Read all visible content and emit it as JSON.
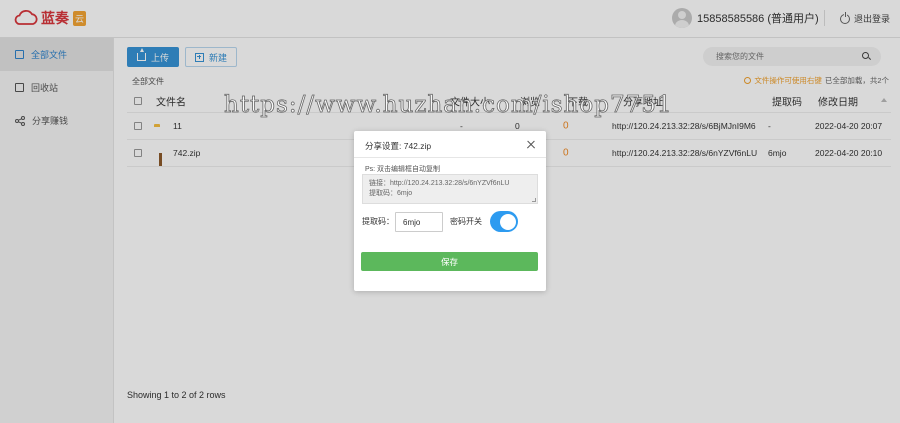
{
  "header": {
    "logo_text": "蓝奏",
    "logo_badge": "云",
    "username": "15858585586 (普通用户)",
    "logout_label": "退出登录"
  },
  "sidebar": {
    "items": [
      {
        "label": "全部文件",
        "icon": "file-icon",
        "active": true
      },
      {
        "label": "回收站",
        "icon": "trash-icon",
        "active": false
      },
      {
        "label": "分享赚钱",
        "icon": "share-icon",
        "active": false
      }
    ]
  },
  "toolbar": {
    "upload_label": "上传",
    "new_label": "新建",
    "search_placeholder": "搜索您的文件"
  },
  "breadcrumb": "全部文件",
  "status": {
    "warning": "文件操作可使用右键",
    "loaded": "已全部加载，共2个"
  },
  "table": {
    "columns": [
      "文件名",
      "文件大小",
      "浏览",
      "下载",
      "分享地址",
      "提取码",
      "修改日期"
    ],
    "rows": [
      {
        "name": "11",
        "type": "folder",
        "size": "-",
        "views": "0",
        "downloads": "0",
        "link": "http://120.24.213.32:28/s/6BjMJnI9M6",
        "code": "-",
        "date": "2022-04-20 20:07"
      },
      {
        "name": "742.zip",
        "type": "zip",
        "size": "",
        "views": "",
        "downloads": "0",
        "link": "http://120.24.213.32:28/s/6nYZVf6nLU",
        "code": "6mjo",
        "date": "2022-04-20 20:10"
      }
    ]
  },
  "footer": "Showing 1 to 2 of 2 rows",
  "watermark": "https://www.huzhan.com/ishop7751",
  "modal": {
    "title": "分享设置: 742.zip",
    "ps": "Ps: 双击编辑框自动复制",
    "link_line": "链接：http://120.24.213.32:28/s/6nYZVf6nLU",
    "code_line": "提取码：6mjo",
    "code_label": "提取码：",
    "code_value": "6mjo",
    "switch_label": "密码开关",
    "switch_on": true,
    "save_label": "保存"
  },
  "colors": {
    "accent": "#3793d6",
    "save": "#5cb85c",
    "toggle": "#2d9bf0",
    "download_count": "#f08a24"
  }
}
